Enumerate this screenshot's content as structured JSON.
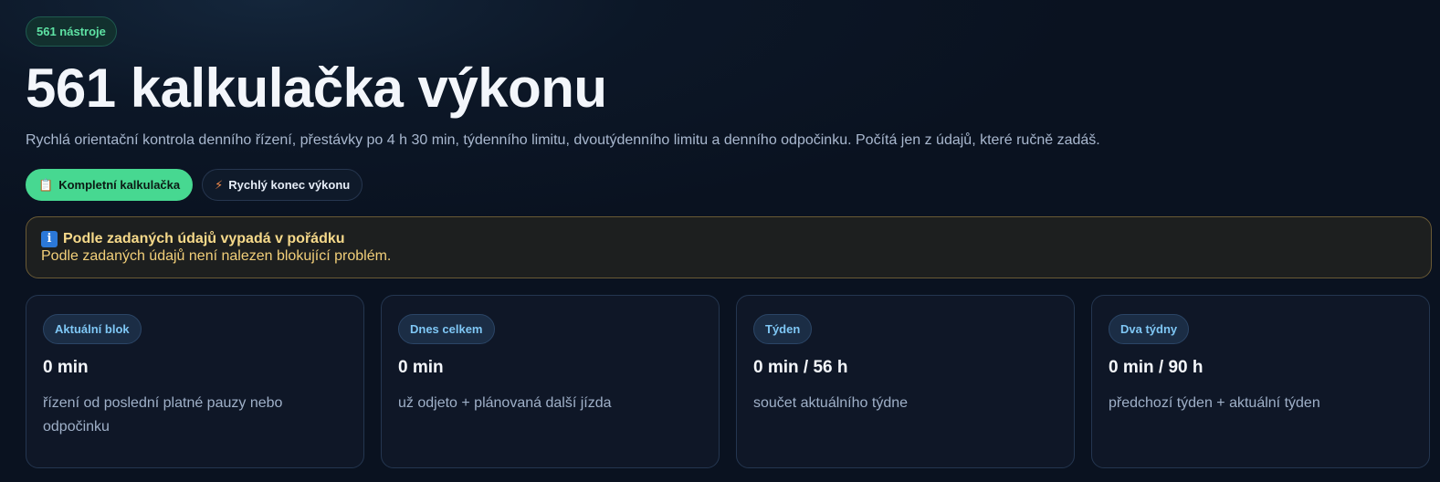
{
  "header": {
    "badge": "561 nástroje",
    "title": "561 kalkulačka výkonu",
    "subtitle": "Rychlá orientační kontrola denního řízení, přestávky po 4 h 30 min, týdenního limitu, dvoutýdenního limitu a denního odpočinku. Počítá jen z údajů, které ručně zadáš."
  },
  "tabs": [
    {
      "icon": "📋",
      "icon_name": "clipboard-icon",
      "label": "Kompletní kalkulačka",
      "active": true
    },
    {
      "icon": "⚡",
      "icon_name": "lightning-icon",
      "label": "Rychlý konec výkonu",
      "active": false
    }
  ],
  "alert": {
    "icon": "i",
    "icon_name": "info-icon",
    "title": "Podle zadaných údajů vypadá v pořádku",
    "text": "Podle zadaných údajů není nalezen blokující problém."
  },
  "cards": [
    {
      "tag": "Aktuální blok",
      "value": "0 min",
      "desc": "řízení od poslední platné pauzy nebo odpočinku"
    },
    {
      "tag": "Dnes celkem",
      "value": "0 min",
      "desc": "už odjeto + plánovaná další jízda"
    },
    {
      "tag": "Týden",
      "value": "0 min / 56 h",
      "desc": "součet aktuálního týdne"
    },
    {
      "tag": "Dva týdny",
      "value": "0 min / 90 h",
      "desc": "předchozí týden + aktuální týden"
    }
  ],
  "colors": {
    "accent_green": "#47d891",
    "badge_green_text": "#5ee2a4",
    "alert_text": "#f2cf79",
    "card_tag_text": "#7fc7f5",
    "background": "#0a1220"
  }
}
